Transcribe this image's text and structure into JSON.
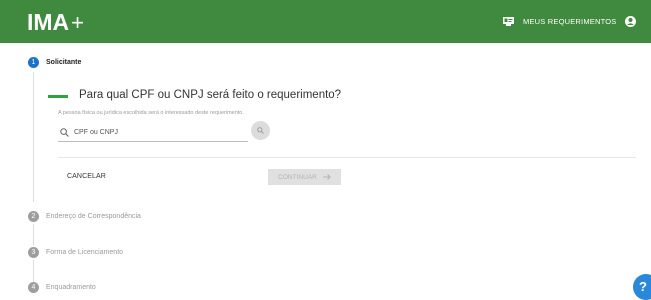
{
  "header": {
    "logo_text": "IMA",
    "logo_plus": "+",
    "my_requests_label": "MEUS REQUERIMENTOS",
    "my_requests_icon": "id-card-icon",
    "user_icon": "user-circle-icon",
    "background_color": "#3f8a3f"
  },
  "steps": [
    {
      "number": "1",
      "label": "Solicitante",
      "active": true
    },
    {
      "number": "2",
      "label": "Endereço de Correspondência",
      "active": false
    },
    {
      "number": "3",
      "label": "Forma de Licenciamento",
      "active": false
    },
    {
      "number": "4",
      "label": "Enquadramento",
      "active": false
    }
  ],
  "form": {
    "question": "Para qual CPF ou CNPJ será feito o requerimento?",
    "subtitle": "A pessoa física ou jurídica escolhida será o interessado deste requerimento.",
    "input_placeholder": "CPF ou CNPJ",
    "input_value": "",
    "search_icon": "search-icon"
  },
  "actions": {
    "cancel_label": "CANCELAR",
    "continue_label": "CONTINUAR",
    "continue_icon": "arrow-right-icon"
  },
  "help": {
    "label": "?"
  },
  "colors": {
    "accent_green": "#2fa044",
    "step_active": "#1a73c8",
    "step_inactive": "#9e9e9e",
    "help_blue": "#2a88d8"
  }
}
